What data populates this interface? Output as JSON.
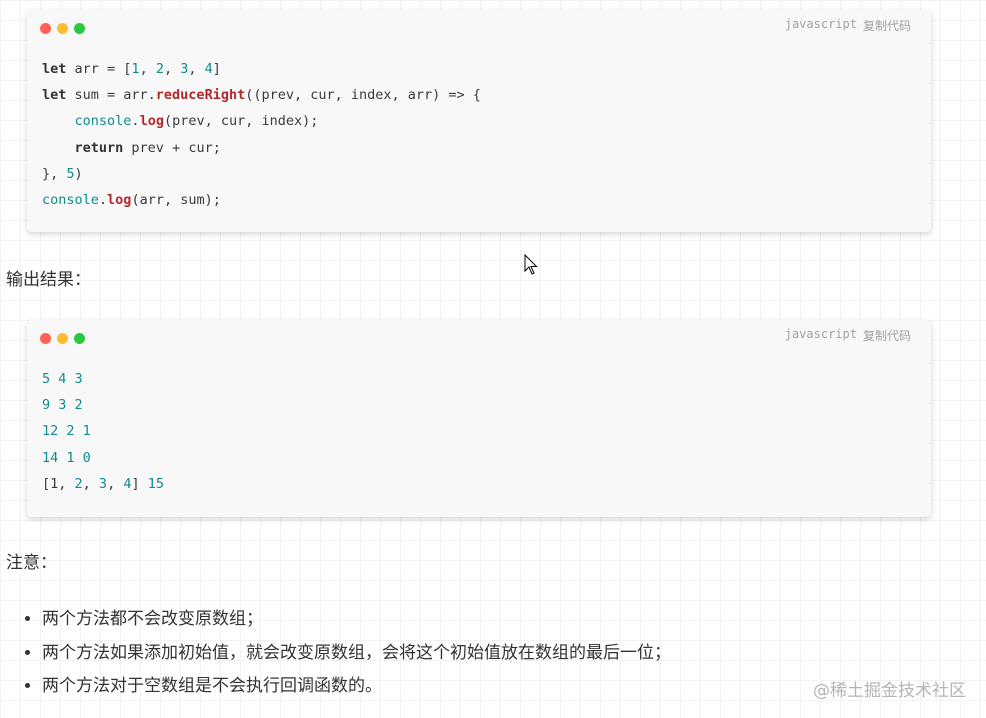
{
  "card1": {
    "lang": "javascript",
    "copy": "复制代码",
    "lines": [
      [
        {
          "t": "let",
          "c": "kw"
        },
        {
          "t": " arr = ["
        },
        {
          "t": "1",
          "c": "num"
        },
        {
          "t": ", "
        },
        {
          "t": "2",
          "c": "num"
        },
        {
          "t": ", "
        },
        {
          "t": "3",
          "c": "num"
        },
        {
          "t": ", "
        },
        {
          "t": "4",
          "c": "num"
        },
        {
          "t": "]"
        }
      ],
      [
        {
          "t": "let",
          "c": "kw"
        },
        {
          "t": " sum = arr."
        },
        {
          "t": "reduceRight",
          "c": "fn"
        },
        {
          "t": "((prev, cur, index, arr) => {"
        }
      ],
      [
        {
          "t": "    "
        },
        {
          "t": "console",
          "c": "bi"
        },
        {
          "t": "."
        },
        {
          "t": "log",
          "c": "fn"
        },
        {
          "t": "(prev, cur, index);"
        }
      ],
      [
        {
          "t": "    "
        },
        {
          "t": "return",
          "c": "kw"
        },
        {
          "t": " prev + cur;"
        }
      ],
      [
        {
          "t": "}, "
        },
        {
          "t": "5",
          "c": "num"
        },
        {
          "t": ")"
        }
      ],
      [
        {
          "t": "console",
          "c": "bi"
        },
        {
          "t": "."
        },
        {
          "t": "log",
          "c": "fn"
        },
        {
          "t": "(arr, sum);"
        }
      ]
    ]
  },
  "output_heading": "输出结果：",
  "card2": {
    "lang": "javascript",
    "copy": "复制代码",
    "lines": [
      [
        {
          "t": "5 4 3",
          "c": "out"
        }
      ],
      [
        {
          "t": "9 3 2",
          "c": "out"
        }
      ],
      [
        {
          "t": "12 2 1",
          "c": "out"
        }
      ],
      [
        {
          "t": "14 1 0",
          "c": "out"
        }
      ],
      [
        {
          "t": "[1, "
        },
        {
          "t": "2",
          "c": "num"
        },
        {
          "t": ", "
        },
        {
          "t": "3",
          "c": "num"
        },
        {
          "t": ", "
        },
        {
          "t": "4",
          "c": "num"
        },
        {
          "t": "] "
        },
        {
          "t": "15",
          "c": "num"
        }
      ]
    ]
  },
  "note_heading": "注意：",
  "notes": [
    "两个方法都不会改变原数组；",
    "两个方法如果添加初始值，就会改变原数组，会将这个初始值放在数组的最后一位；",
    "两个方法对于空数组是不会执行回调函数的。"
  ],
  "watermark": "@稀土掘金技术社区",
  "colors": {
    "dot_red": "#fe5f58",
    "dot_yellow": "#febc2e",
    "dot_green": "#28c840",
    "number": "#0e8d8f",
    "function": "#b3282c"
  }
}
